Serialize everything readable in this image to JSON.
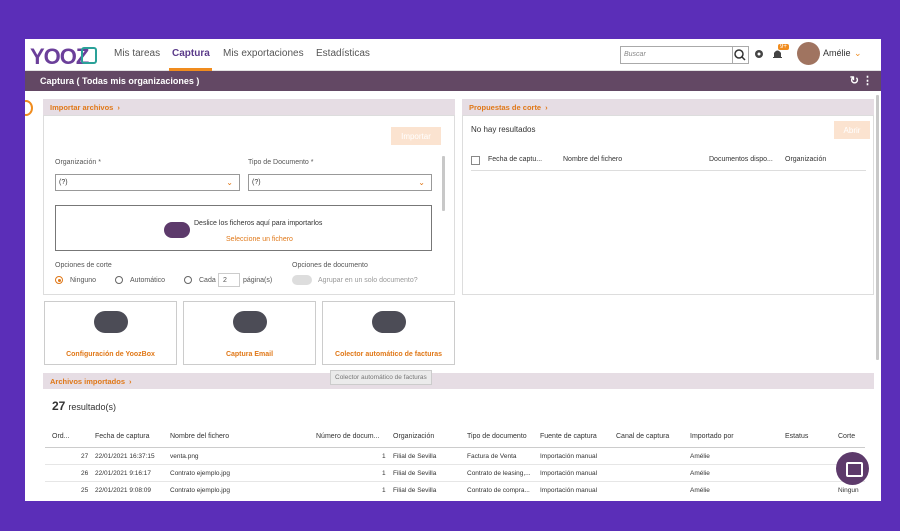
{
  "app": {
    "logo": "YOOZ",
    "nav": [
      "Mis tareas",
      "Captura",
      "Mis exportaciones",
      "Estadísticas"
    ],
    "search_placeholder": "Buscar",
    "notif_count": "9+",
    "user": "Amélie"
  },
  "page": {
    "title": "Captura ( Todas mis organizaciones )"
  },
  "importar": {
    "header": "Importar archivos",
    "btn": "Importar",
    "org_label": "Organización *",
    "org_value": "(?)",
    "tipo_label": "Tipo de Documento *",
    "tipo_value": "(?)",
    "drop_text": "Deslice los ficheros aquí para importarlos",
    "drop_link": "Seleccione un fichero",
    "corte_label": "Opciones de corte",
    "opt_ninguno": "Ninguno",
    "opt_auto": "Automático",
    "opt_cada": "Cada",
    "cada_value": "2",
    "paginas": "página(s)",
    "doc_label": "Opciones de documento",
    "agrupar": "Agrupar en un solo documento?"
  },
  "propuestas": {
    "header": "Propuestas de corte",
    "empty": "No hay resultados",
    "btn": "Abrir",
    "cols": [
      "Fecha de captu...",
      "Nombre del fichero",
      "Documentos dispo...",
      "Organización"
    ]
  },
  "tiles": [
    {
      "label": "Configuración de YoozBox"
    },
    {
      "label": "Captura Email"
    },
    {
      "label": "Colector automático de facturas"
    }
  ],
  "tooltip": "Colector automático de facturas",
  "archivos": {
    "header": "Archivos importados",
    "count": "27",
    "count_suffix": "resultado(s)",
    "cols": [
      "Ord...",
      "Fecha de captura",
      "Nombre del fichero",
      "Número de docum...",
      "Organización",
      "Tipo de documento",
      "Fuente de captura",
      "Canal de captura",
      "Importado por",
      "Estatus",
      "Corte"
    ],
    "rows": [
      [
        "27",
        "22/01/2021 16:37:15",
        "venta.png",
        "1",
        "Filial de Sevilla",
        "Factura de Venta",
        "Importación manual",
        "",
        "Amélie",
        "",
        ""
      ],
      [
        "26",
        "22/01/2021 9:16:17",
        "Contrato ejemplo.jpg",
        "1",
        "Filial de Sevilla",
        "Contrato de leasing,...",
        "Importación manual",
        "",
        "Amélie",
        "",
        ""
      ],
      [
        "25",
        "22/01/2021 9:08:09",
        "Contrato ejemplo.jpg",
        "1",
        "Filial de Sevilla",
        "Contrato de compra...",
        "Importación manual",
        "",
        "Amélie",
        "",
        "Ningun"
      ]
    ]
  }
}
